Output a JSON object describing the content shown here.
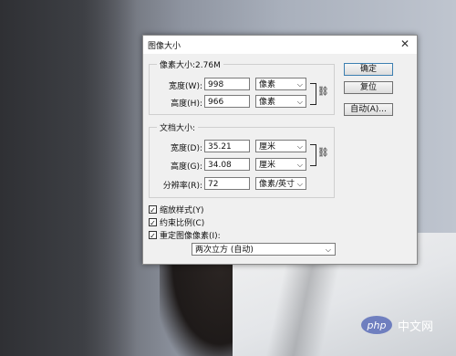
{
  "dialog": {
    "title": "图像大小",
    "close_glyph": "✕",
    "pixel_dimensions": {
      "legend": "像素大小:2.76M",
      "width_label": "宽度(W):",
      "width_value": "998",
      "width_unit": "像素",
      "height_label": "高度(H):",
      "height_value": "966",
      "height_unit": "像素"
    },
    "document_size": {
      "legend": "文档大小:",
      "width_label": "宽度(D):",
      "width_value": "35.21",
      "width_unit": "厘米",
      "height_label": "高度(G):",
      "height_value": "34.08",
      "height_unit": "厘米",
      "resolution_label": "分辨率(R):",
      "resolution_value": "72",
      "resolution_unit": "像素/英寸"
    },
    "buttons": {
      "ok": "确定",
      "reset": "复位",
      "auto": "自动(A)..."
    },
    "options": {
      "scale_styles": "缩放样式(Y)",
      "constrain_proportions": "约束比例(C)",
      "resample": "重定图像像素(I):",
      "resample_method": "两次立方 (自动)"
    },
    "icons": {
      "chain": "chain-link-icon",
      "dropdown": "chevron-down-icon",
      "check": "checkmark-icon"
    }
  },
  "watermark": {
    "logo_text": "php",
    "text": "中文网"
  }
}
